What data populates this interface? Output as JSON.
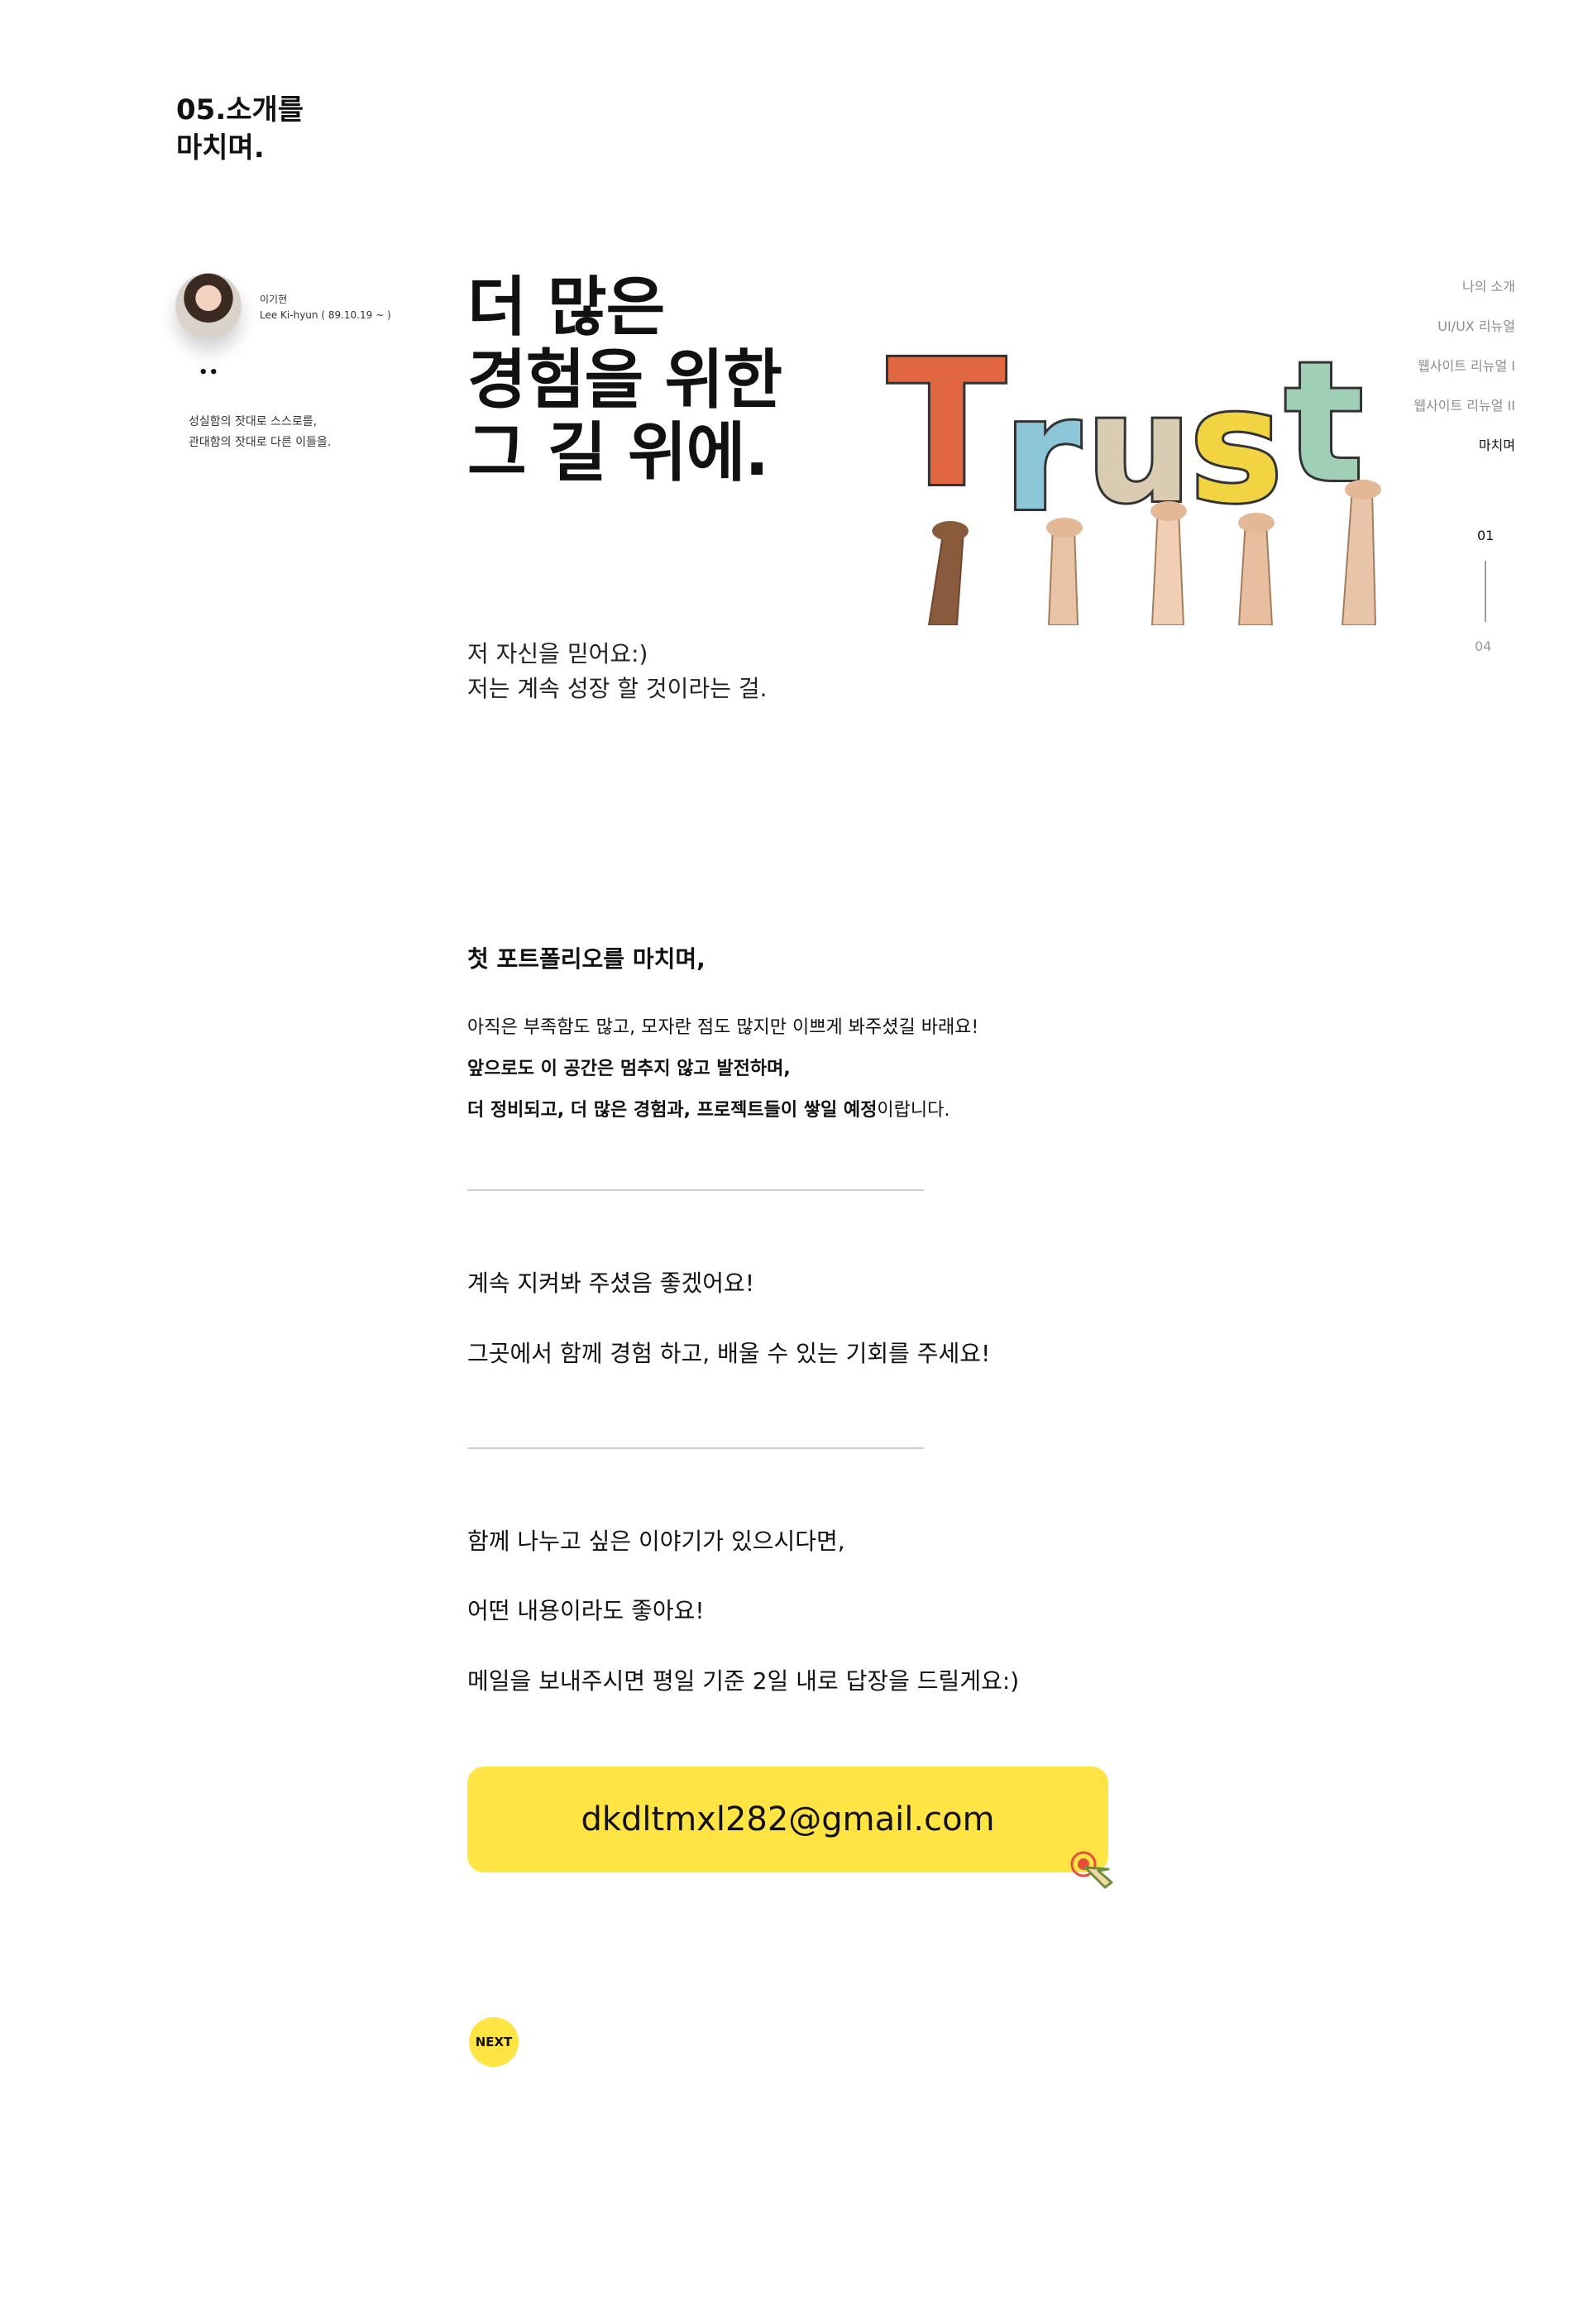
{
  "section": {
    "title_line1": "05.소개를",
    "title_line2": "마치며."
  },
  "profile": {
    "name": "이기현",
    "name_en": "Lee Ki-hyun ( 89.10.19 ~ )",
    "dots": "••",
    "motto_line1": "성실함의 잣대로 스스로를,",
    "motto_line2": "관대함의 잣대로 다른 이들을."
  },
  "headline": {
    "line1": "더 많은",
    "line2": "경험을 위한",
    "line3": "그 길 위에."
  },
  "hero_image": {
    "word": "Trust",
    "letter_colors": [
      "#e0673f",
      "#8ec6d9",
      "#d9ccb3",
      "#f2d443",
      "#9fd0b6"
    ]
  },
  "side_nav": {
    "items": [
      {
        "label": "나의 소개"
      },
      {
        "label": "UI/UX 리뉴얼"
      },
      {
        "label": "웹사이트 리뉴얼 I"
      },
      {
        "label": "웹사이트 리뉴얼 II"
      },
      {
        "label": "마치며"
      }
    ],
    "page_current": "01",
    "page_total": "04"
  },
  "intro": {
    "line1": "저 자신을 믿어요:)",
    "line2": "저는 계속 성장 할 것이라는 걸."
  },
  "closing": {
    "title": "첫 포트폴리오를 마치며,",
    "line1": "아직은 부족함도 많고, 모자란 점도 많지만 이쁘게 봐주셨길 바래요!",
    "line2": "앞으로도 이 공간은 멈추지 않고 발전하며,",
    "line3_bold": "더 정비되고, 더 많은 경험과, 프로젝트들이 쌓일 예정",
    "line3_rest": "이랍니다."
  },
  "watch": {
    "line1": "계속 지켜봐 주셨음 좋겠어요!",
    "line2": "그곳에서 함께 경험 하고, 배울 수 있는 기회를 주세요!"
  },
  "contact": {
    "line1": "함께 나누고 싶은 이야기가 있으시다면,",
    "line2": "어떤 내용이라도 좋아요!",
    "line3": "메일을 보내주시면 평일 기준 2일 내로 답장을 드릴게요:)",
    "email": "dkdltmxl282@gmail.com"
  },
  "next": {
    "label": "NEXT"
  },
  "colors": {
    "accent": "#ffe443",
    "divider": "#cfcfcf",
    "nav_inactive": "#8d8d8d"
  },
  "icons": {
    "email_button": "click-pointer-icon"
  }
}
